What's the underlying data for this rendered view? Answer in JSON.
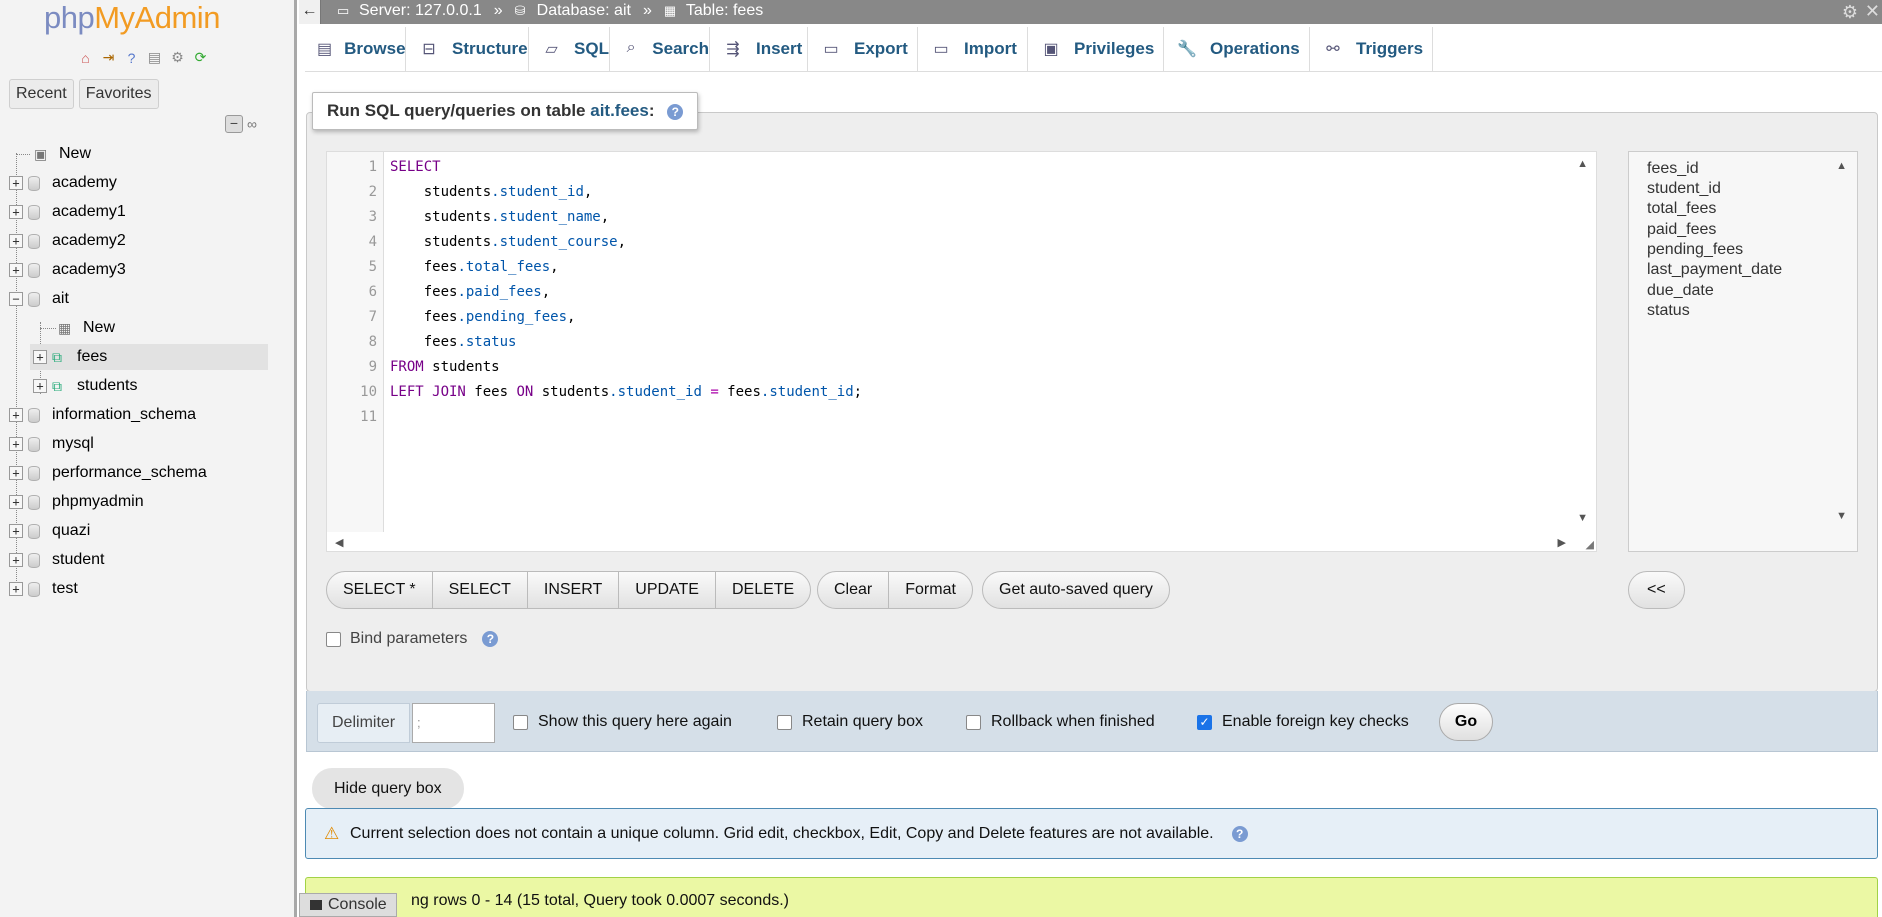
{
  "nav": {
    "logo_php": "php",
    "logo_my": "My",
    "logo_admin": "Admin",
    "tab_recent": "Recent",
    "tab_favorites": "Favorites",
    "tree": [
      {
        "label": "New",
        "kind": "new"
      },
      {
        "label": "academy",
        "kind": "db"
      },
      {
        "label": "academy1",
        "kind": "db"
      },
      {
        "label": "academy2",
        "kind": "db"
      },
      {
        "label": "academy3",
        "kind": "db"
      },
      {
        "label": "ait",
        "kind": "db-open"
      },
      {
        "label": "New",
        "kind": "new-child"
      },
      {
        "label": "fees",
        "kind": "table-selected"
      },
      {
        "label": "students",
        "kind": "table"
      },
      {
        "label": "information_schema",
        "kind": "db"
      },
      {
        "label": "mysql",
        "kind": "db"
      },
      {
        "label": "performance_schema",
        "kind": "db"
      },
      {
        "label": "phpmyadmin",
        "kind": "db"
      },
      {
        "label": "quazi",
        "kind": "db"
      },
      {
        "label": "student",
        "kind": "db"
      },
      {
        "label": "test",
        "kind": "db"
      }
    ]
  },
  "topbar": {
    "server": "Server: 127.0.0.1",
    "database": "Database: ait",
    "table": "Table: fees",
    "sep": "»"
  },
  "menu": {
    "browse": "Browse",
    "structure": "Structure",
    "sql": "SQL",
    "search": "Search",
    "insert": "Insert",
    "export": "Export",
    "import": "Import",
    "privileges": "Privileges",
    "operations": "Operations",
    "triggers": "Triggers"
  },
  "sql_panel": {
    "legend_prefix": "Run SQL query/queries on table ",
    "legend_table": "ait.fees",
    "legend_suffix": ":",
    "line_numbers": [
      "1",
      "2",
      "3",
      "4",
      "5",
      "6",
      "7",
      "8",
      "9",
      "10",
      "11"
    ],
    "columns": [
      "fees_id",
      "student_id",
      "total_fees",
      "paid_fees",
      "pending_fees",
      "last_payment_date",
      "due_date",
      "status"
    ],
    "buttons_group1": [
      "SELECT *",
      "SELECT",
      "INSERT",
      "UPDATE",
      "DELETE"
    ],
    "buttons_group2": [
      "Clear",
      "Format"
    ],
    "auto_saved": "Get auto-saved query",
    "collapse_columns": "<<",
    "bind_parameters": "Bind parameters"
  },
  "options": {
    "delimiter_label": "Delimiter",
    "delimiter_value": ";",
    "show_query_again": "Show this query here again",
    "retain_query_box": "Retain query box",
    "rollback": "Rollback when finished",
    "foreign_key_checks": "Enable foreign key checks",
    "go": "Go"
  },
  "hide_query_box": "Hide query box",
  "notice": "Current selection does not contain a unique column. Grid edit, checkbox, Edit, Copy and Delete features are not available.",
  "success": "ng rows 0 - 14 (15 total, Query took 0.0007 seconds.)",
  "console": "Console"
}
